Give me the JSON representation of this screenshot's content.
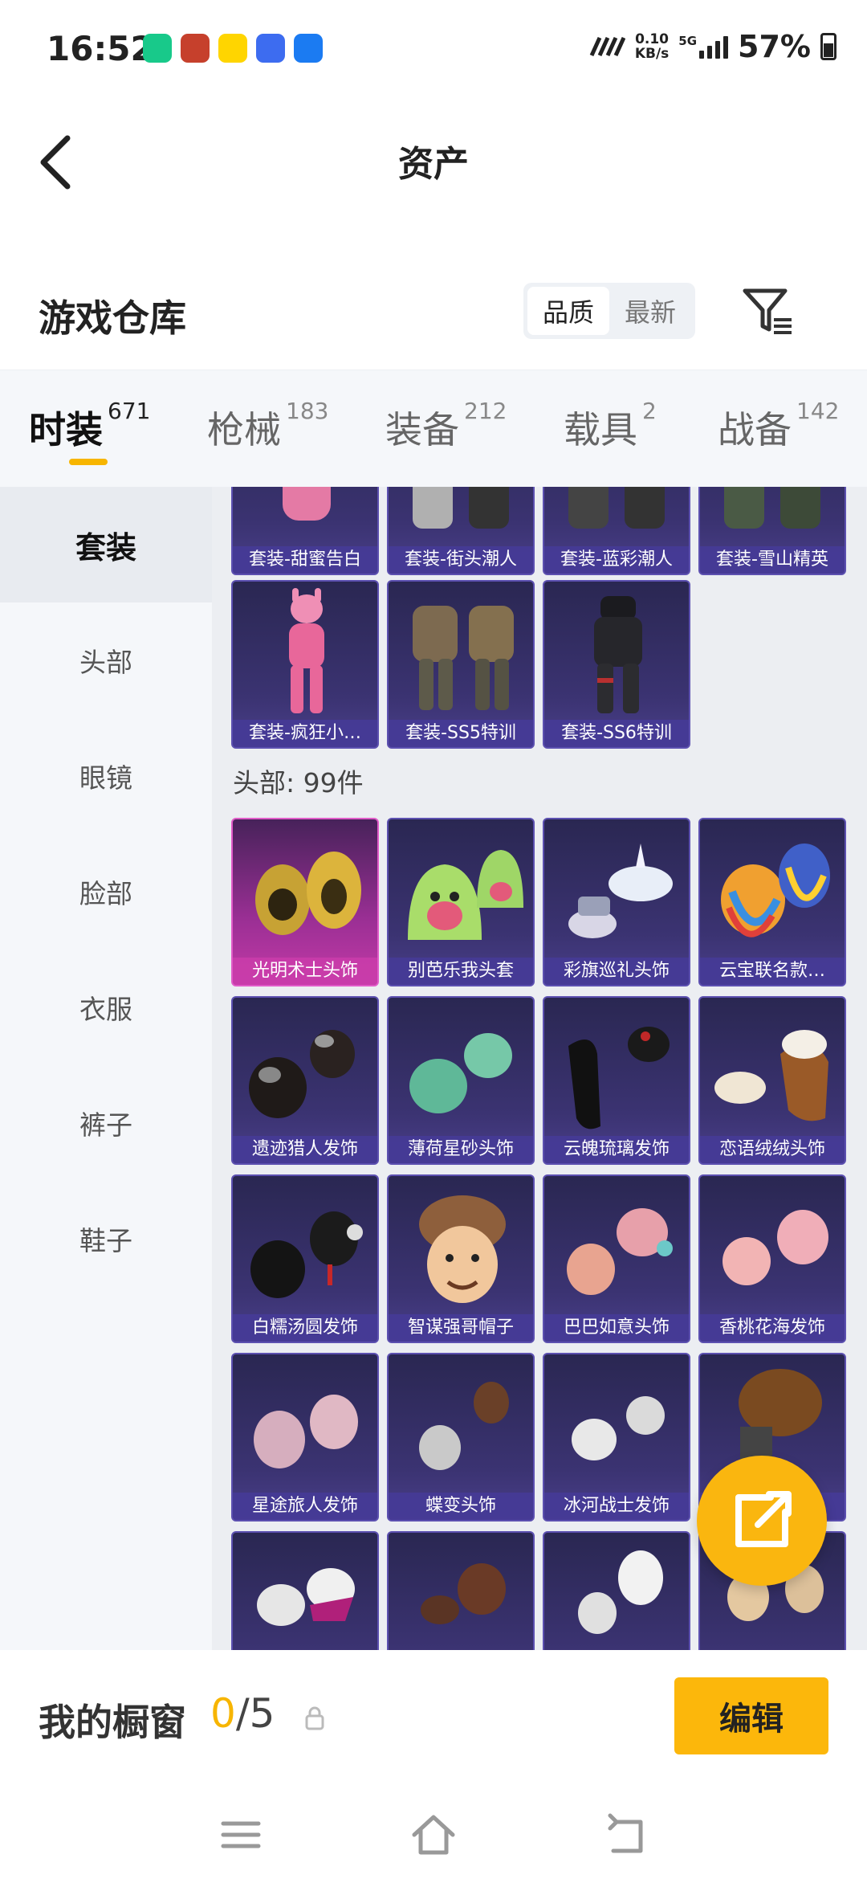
{
  "status_bar": {
    "time": "16:52",
    "net_speed_value": "0.10",
    "net_speed_unit": "KB/s",
    "network": "5G",
    "battery": "57%"
  },
  "nav": {
    "title": "资产"
  },
  "warehouse": {
    "title": "游戏仓库",
    "sort_options": [
      "品质",
      "最新"
    ],
    "sort_selected": "品质"
  },
  "categories": [
    {
      "name": "时装",
      "count": "671",
      "active": true
    },
    {
      "name": "枪械",
      "count": "183"
    },
    {
      "name": "装备",
      "count": "212"
    },
    {
      "name": "载具",
      "count": "2"
    },
    {
      "name": "战备",
      "count": "142"
    }
  ],
  "sidebar": {
    "items": [
      {
        "label": "套装",
        "active": true
      },
      {
        "label": "头部"
      },
      {
        "label": "眼镜"
      },
      {
        "label": "脸部"
      },
      {
        "label": "衣服"
      },
      {
        "label": "裤子"
      },
      {
        "label": "鞋子"
      }
    ]
  },
  "suits": {
    "items": [
      {
        "label": "套装-甜蜜告白"
      },
      {
        "label": "套装-街头潮人"
      },
      {
        "label": "套装-蓝彩潮人"
      },
      {
        "label": "套装-雪山精英"
      },
      {
        "label": "套装-疯狂小…"
      },
      {
        "label": "套装-SS5特训"
      },
      {
        "label": "套装-SS6特训"
      }
    ]
  },
  "head": {
    "section_title": "头部: 99件",
    "items": [
      {
        "label": "光明术士头饰"
      },
      {
        "label": "别芭乐我头套"
      },
      {
        "label": "彩旗巡礼头饰"
      },
      {
        "label": "云宝联名款…"
      },
      {
        "label": "遗迹猎人发饰"
      },
      {
        "label": "薄荷星砂头饰"
      },
      {
        "label": "云魄琉璃发饰"
      },
      {
        "label": "恋语绒绒头饰"
      },
      {
        "label": "白糯汤圆发饰"
      },
      {
        "label": "智谋强哥帽子"
      },
      {
        "label": "巴巴如意头饰"
      },
      {
        "label": "香桃花海发饰"
      },
      {
        "label": "星途旅人发饰"
      },
      {
        "label": "蝶变头饰"
      },
      {
        "label": "冰河战士发饰"
      },
      {
        "label": ""
      }
    ]
  },
  "showcase": {
    "title": "我的橱窗",
    "current": "0",
    "total": "/5",
    "edit_label": "编辑"
  }
}
